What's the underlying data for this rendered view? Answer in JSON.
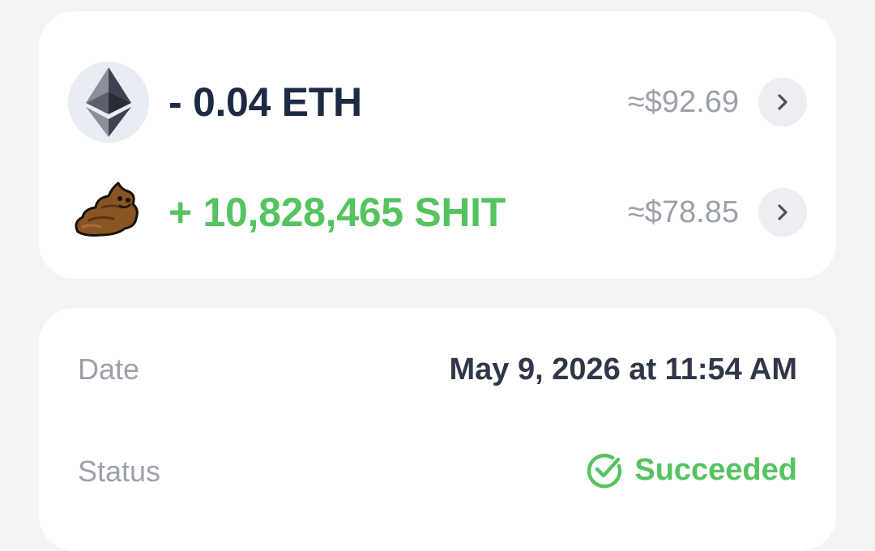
{
  "assets": [
    {
      "token_icon": "ethereum-icon",
      "amount": "- 0.04 ETH",
      "usd_value": "≈$92.69",
      "direction": "outgoing",
      "color": "#1d2a44"
    },
    {
      "token_icon": "poop-token-icon",
      "amount": "+ 10,828,465 SHIT",
      "usd_value": "≈$78.85",
      "direction": "incoming",
      "color": "#55c360"
    }
  ],
  "details": {
    "date_label": "Date",
    "date_value": "May 9, 2026 at 11:54 AM",
    "status_label": "Status",
    "status_value": "Succeeded",
    "status_icon": "check-circle-icon",
    "status_color": "#55c360"
  }
}
